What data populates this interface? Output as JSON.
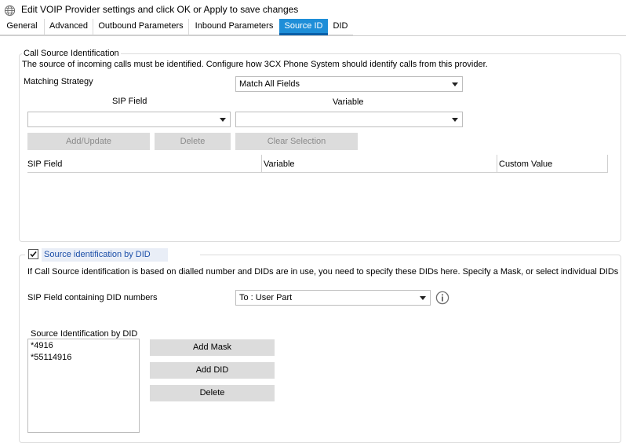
{
  "window": {
    "icon": "globe-icon",
    "title": "Edit VOIP Provider settings and click OK or Apply to save changes"
  },
  "tabs": [
    {
      "label": "General",
      "active": false
    },
    {
      "label": "Advanced",
      "active": false
    },
    {
      "label": "Outbound Parameters",
      "active": false
    },
    {
      "label": "Inbound Parameters",
      "active": false
    },
    {
      "label": "Source ID",
      "active": true
    },
    {
      "label": "DID",
      "active": false
    }
  ],
  "call_source": {
    "legend": "Call Source Identification",
    "description": "The source of incoming calls must be identified. Configure how 3CX Phone System should identify calls from this provider.",
    "matching_strategy_label": "Matching Strategy",
    "matching_strategy_value": "Match All Fields",
    "sip_field_label": "SIP Field",
    "variable_label": "Variable",
    "sip_field_value": "",
    "variable_value": "",
    "buttons": {
      "add_update": "Add/Update",
      "delete": "Delete",
      "clear_selection": "Clear Selection"
    },
    "table": {
      "columns": [
        "SIP Field",
        "Variable",
        "Custom Value"
      ],
      "rows": []
    }
  },
  "did_source": {
    "checkbox_label": "Source identification by DID",
    "checked": true,
    "description": "If Call Source identification is based on dialled number and DIDs are in use, you need to specify these DIDs here. Specify a Mask, or select individual DIDs",
    "sip_field_did_label": "SIP Field containing DID numbers",
    "sip_field_did_value": "To : User Part",
    "info_icon": "info-icon",
    "list_label": "Source Identification by DID",
    "list_items": [
      "*4916",
      "*55114916"
    ],
    "buttons": {
      "add_mask": "Add Mask",
      "add_did": "Add DID",
      "delete": "Delete"
    }
  },
  "colors": {
    "active_tab": "#1e8ed8",
    "checkbox_label": "#1c4fa8",
    "button_bg": "#dcdcdc"
  }
}
